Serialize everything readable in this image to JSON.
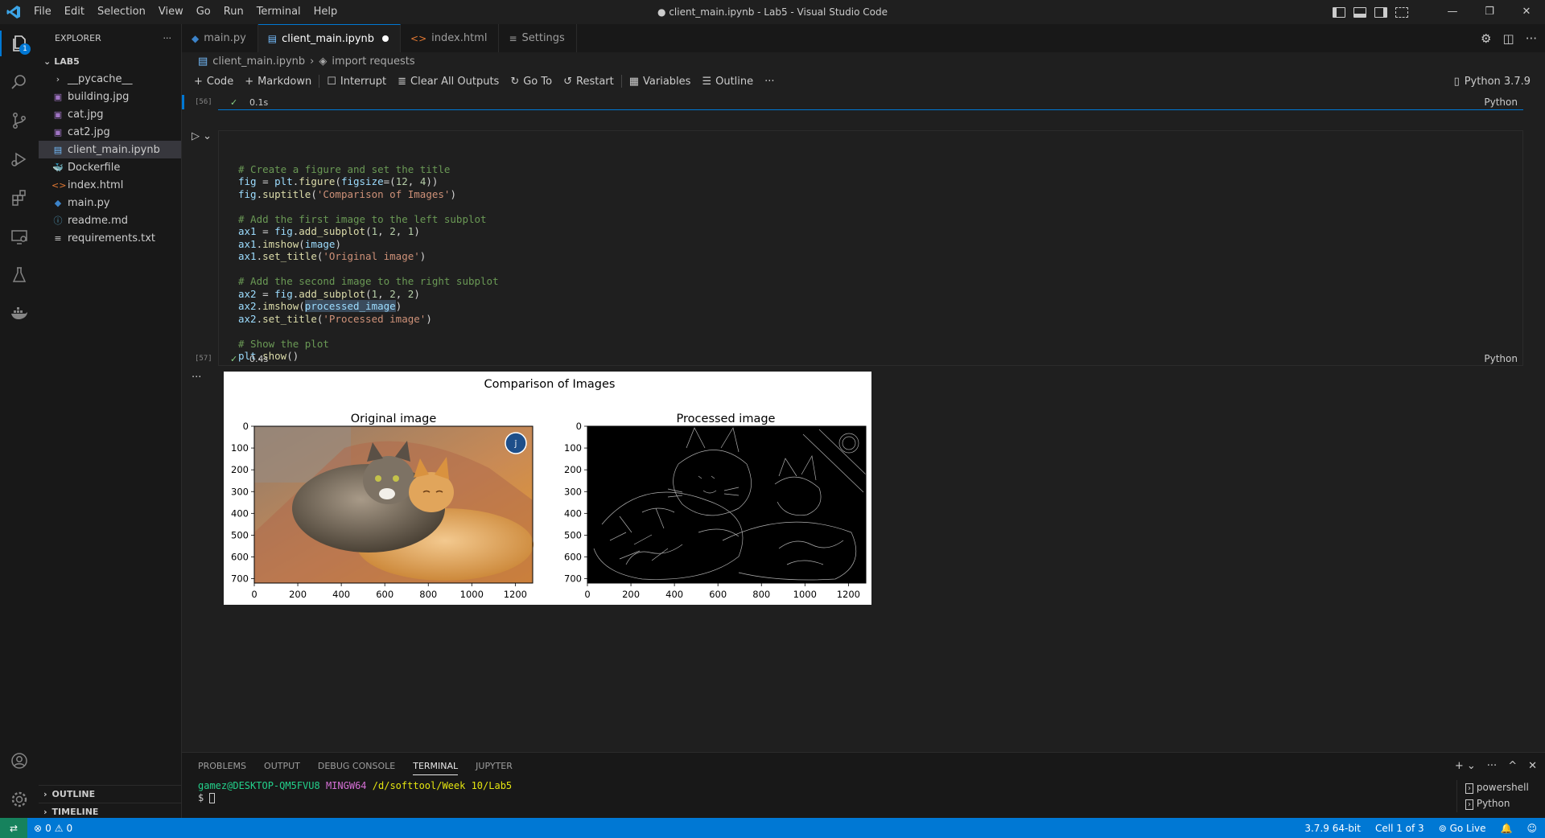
{
  "menu": [
    "File",
    "Edit",
    "Selection",
    "View",
    "Go",
    "Run",
    "Terminal",
    "Help"
  ],
  "window_title": "● client_main.ipynb - Lab5 - Visual Studio Code",
  "explorer": {
    "header": "EXPLORER",
    "root": "LAB5",
    "files": [
      {
        "name": "__pycache__",
        "icon": "folder-icon"
      },
      {
        "name": "building.jpg",
        "icon": "image-icon"
      },
      {
        "name": "cat.jpg",
        "icon": "image-icon"
      },
      {
        "name": "cat2.jpg",
        "icon": "image-icon"
      },
      {
        "name": "client_main.ipynb",
        "icon": "notebook-icon"
      },
      {
        "name": "Dockerfile",
        "icon": "docker-icon"
      },
      {
        "name": "index.html",
        "icon": "html-icon"
      },
      {
        "name": "main.py",
        "icon": "python-icon"
      },
      {
        "name": "readme.md",
        "icon": "info-icon"
      },
      {
        "name": "requirements.txt",
        "icon": "text-icon"
      }
    ],
    "outline": "OUTLINE",
    "timeline": "TIMELINE"
  },
  "activity_badge": "1",
  "tabs": [
    "main.py",
    "client_main.ipynb",
    "index.html",
    "Settings"
  ],
  "breadcrumb": [
    "client_main.ipynb",
    "import requests"
  ],
  "toolbar": {
    "code": "Code",
    "markdown": "Markdown",
    "interrupt": "Interrupt",
    "clear": "Clear All Outputs",
    "goto": "Go To",
    "restart": "Restart",
    "variables": "Variables",
    "outline": "Outline",
    "kernel": "Python 3.7.9"
  },
  "prev_cell": {
    "number": "[56]",
    "duration": "0.1s",
    "lang": "Python"
  },
  "code_cell": {
    "number": "[57]",
    "duration": "0.4s",
    "lang": "Python",
    "lines": [
      "# Create a figure and set the title",
      "fig = plt.figure(figsize=(12, 4))",
      "fig.suptitle('Comparison of Images')",
      "",
      "# Add the first image to the left subplot",
      "ax1 = fig.add_subplot(1, 2, 1)",
      "ax1.imshow(image)",
      "ax1.set_title('Original image')",
      "",
      "# Add the second image to the right subplot",
      "ax2 = fig.add_subplot(1, 2, 2)",
      "ax2.imshow(processed_image)",
      "ax2.set_title('Processed image')",
      "",
      "# Show the plot",
      "plt.show()"
    ]
  },
  "output_more": "···",
  "figure": {
    "suptitle": "Comparison of Images",
    "left_title": "Original image",
    "right_title": "Processed image",
    "xticks": [
      0,
      200,
      400,
      600,
      800,
      1000,
      1200
    ],
    "yticks": [
      0,
      100,
      200,
      300,
      400,
      500,
      600,
      700
    ],
    "xlim": [
      0,
      1280
    ],
    "ylim": [
      720,
      0
    ]
  },
  "panel": {
    "tabs": [
      "PROBLEMS",
      "OUTPUT",
      "DEBUG CONSOLE",
      "TERMINAL",
      "JUPYTER"
    ],
    "active": "TERMINAL",
    "prompt_user": "gamez@DESKTOP-QM5FVU8",
    "prompt_env": "MINGW64",
    "prompt_path": "/d/softtool/Week 10/Lab5",
    "prompt_symbol": "$",
    "terminals": [
      "powershell",
      "Python"
    ]
  },
  "statusbar": {
    "errors": "0",
    "warnings": "0",
    "python": "3.7.9 64-bit",
    "cell": "Cell 1 of 3",
    "golive": "Go Live"
  },
  "colors": {
    "accent": "#0078d4",
    "statusbar": "#0078d4",
    "remote": "#16825d"
  }
}
